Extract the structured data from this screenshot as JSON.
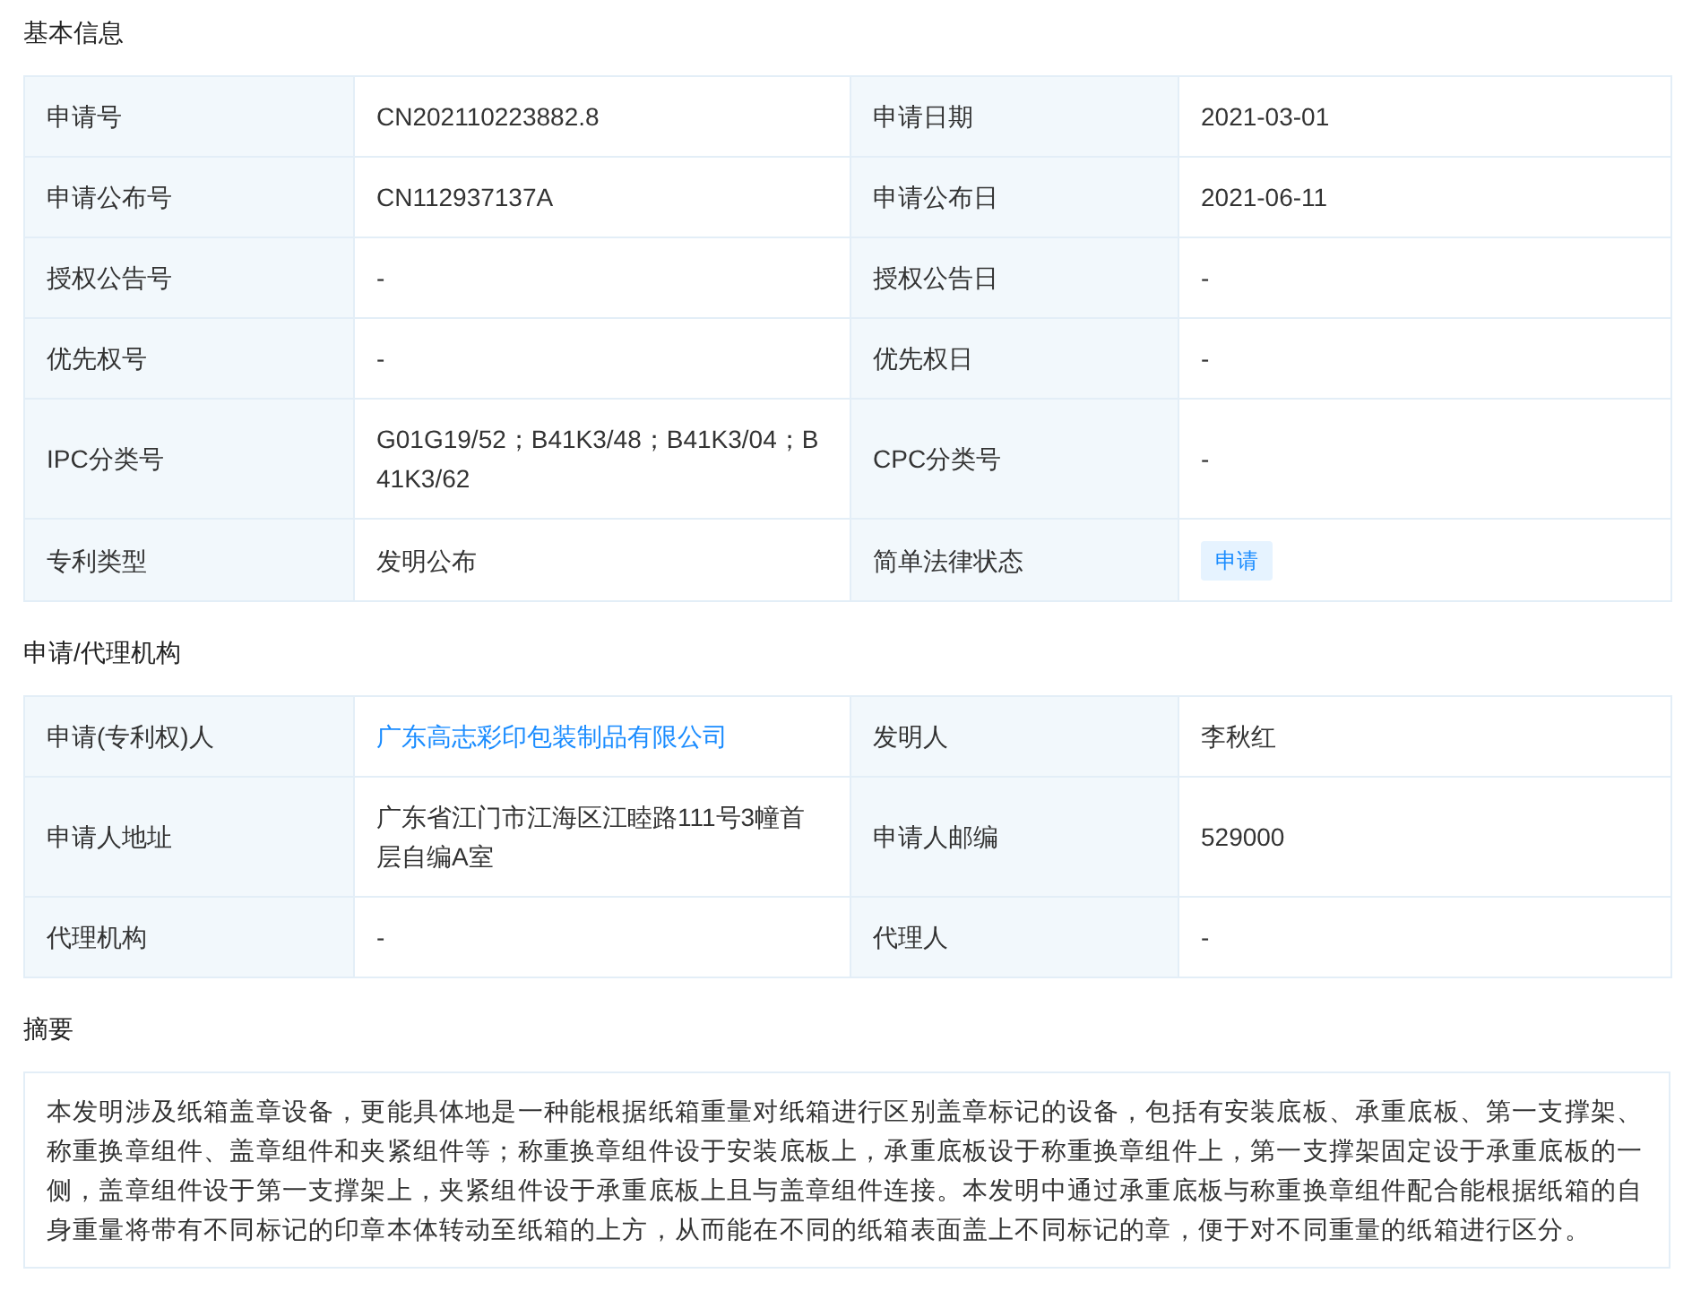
{
  "sections": [
    {
      "title": "基本信息",
      "rows": [
        [
          {
            "label": "申请号",
            "value": "CN202110223882.8",
            "kind": "text"
          },
          {
            "label": "申请日期",
            "value": "2021-03-01",
            "kind": "text"
          }
        ],
        [
          {
            "label": "申请公布号",
            "value": "CN112937137A",
            "kind": "text"
          },
          {
            "label": "申请公布日",
            "value": "2021-06-11",
            "kind": "text"
          }
        ],
        [
          {
            "label": "授权公告号",
            "value": "-",
            "kind": "text"
          },
          {
            "label": "授权公告日",
            "value": "-",
            "kind": "text"
          }
        ],
        [
          {
            "label": "优先权号",
            "value": "-",
            "kind": "text"
          },
          {
            "label": "优先权日",
            "value": "-",
            "kind": "text"
          }
        ],
        [
          {
            "label": "IPC分类号",
            "value": "G01G19/52；B41K3/48；B41K3/04；B41K3/62",
            "kind": "text"
          },
          {
            "label": "CPC分类号",
            "value": "-",
            "kind": "text"
          }
        ],
        [
          {
            "label": "专利类型",
            "value": "发明公布",
            "kind": "text"
          },
          {
            "label": "简单法律状态",
            "value": "申请",
            "kind": "tag"
          }
        ]
      ]
    },
    {
      "title": "申请/代理机构",
      "rows": [
        [
          {
            "label": "申请(专利权)人",
            "value": "广东高志彩印包装制品有限公司",
            "kind": "link"
          },
          {
            "label": "发明人",
            "value": "李秋红",
            "kind": "text"
          }
        ],
        [
          {
            "label": "申请人地址",
            "value": "广东省江门市江海区江睦路111号3幢首层自编A室",
            "kind": "text"
          },
          {
            "label": "申请人邮编",
            "value": "529000",
            "kind": "text"
          }
        ],
        [
          {
            "label": "代理机构",
            "value": "-",
            "kind": "text"
          },
          {
            "label": "代理人",
            "value": "-",
            "kind": "text"
          }
        ]
      ]
    }
  ],
  "abstract": {
    "title": "摘要",
    "text": "本发明涉及纸箱盖章设备，更能具体地是一种能根据纸箱重量对纸箱进行区别盖章标记的设备，包括有安装底板、承重底板、第一支撑架、称重换章组件、盖章组件和夹紧组件等；称重换章组件设于安装底板上，承重底板设于称重换章组件上，第一支撑架固定设于承重底板的一侧，盖章组件设于第一支撑架上，夹紧组件设于承重底板上且与盖章组件连接。本发明中通过承重底板与称重换章组件配合能根据纸箱的自身重量将带有不同标记的印章本体转动至纸箱的上方，从而能在不同的纸箱表面盖上不同标记的章，便于对不同重量的纸箱进行区分。"
  }
}
